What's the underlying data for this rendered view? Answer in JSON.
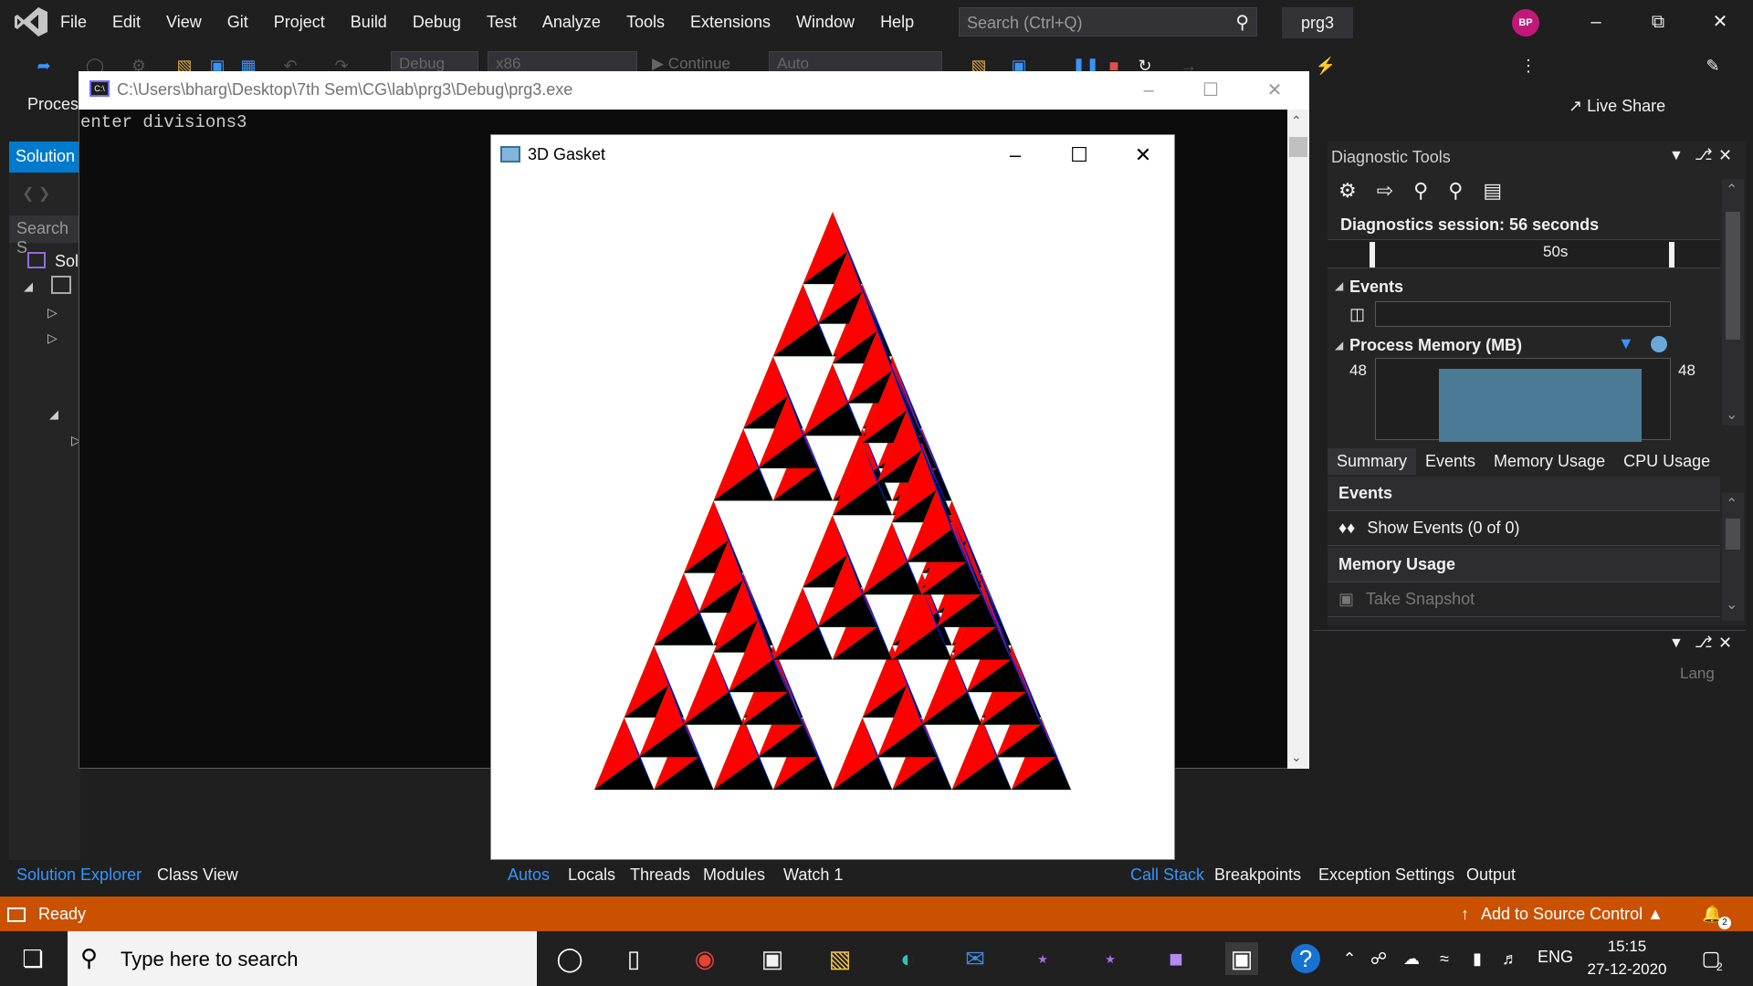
{
  "vs": {
    "menu": [
      "File",
      "Edit",
      "View",
      "Git",
      "Project",
      "Build",
      "Debug",
      "Test",
      "Analyze",
      "Tools",
      "Extensions",
      "Window",
      "Help"
    ],
    "search_placeholder": "Search (Ctrl+Q)",
    "project_name": "prg3",
    "avatar_initials": "BP",
    "toolbar": {
      "config": "Debug",
      "platform": "x86",
      "continue": "Continue",
      "auto": "Auto",
      "live_share": "Live Share",
      "process_label": "Proces"
    }
  },
  "solution_explorer": {
    "tab": "Solution",
    "search": "Search S",
    "item": "Sol"
  },
  "console": {
    "title": "C:\\Users\\bharg\\Desktop\\7th Sem\\CG\\lab\\prg3\\Debug\\prg3.exe",
    "icon_label": "C:\\",
    "text": "enter divisions3"
  },
  "gasket": {
    "title": "3D Gasket",
    "colors": {
      "face1": "#00ff00",
      "face2": "#ff0000",
      "face3": "#0000ff",
      "face4": "#000000"
    }
  },
  "diagnostics": {
    "title": "Diagnostic Tools",
    "session": "Diagnostics session: 56 seconds",
    "timeline_label": "50s",
    "events_header": "Events",
    "memory_header": "Process Memory (MB)",
    "memory_left": "48",
    "memory_right": "48",
    "tabs": [
      "Summary",
      "Events",
      "Memory Usage",
      "CPU Usage"
    ],
    "rows": {
      "events_title": "Events",
      "show_events": "Show Events (0 of 0)",
      "memory_title": "Memory Usage",
      "take_snapshot": "Take Snapshot"
    }
  },
  "lower_right": {
    "lang": "Lang"
  },
  "bottom_tabs": {
    "left": [
      "Solution Explorer",
      "Class View"
    ],
    "middle": [
      "Autos",
      "Locals",
      "Threads",
      "Modules",
      "Watch 1"
    ],
    "right": [
      "Call Stack",
      "Breakpoints",
      "Exception Settings",
      "Output"
    ]
  },
  "status": {
    "ready": "Ready",
    "source_control": "Add to Source Control",
    "notif_count": "2"
  },
  "taskbar": {
    "search_placeholder": "Type here to search",
    "lang": "ENG",
    "time": "15:15",
    "date": "27-12-2020",
    "notif": "2"
  }
}
